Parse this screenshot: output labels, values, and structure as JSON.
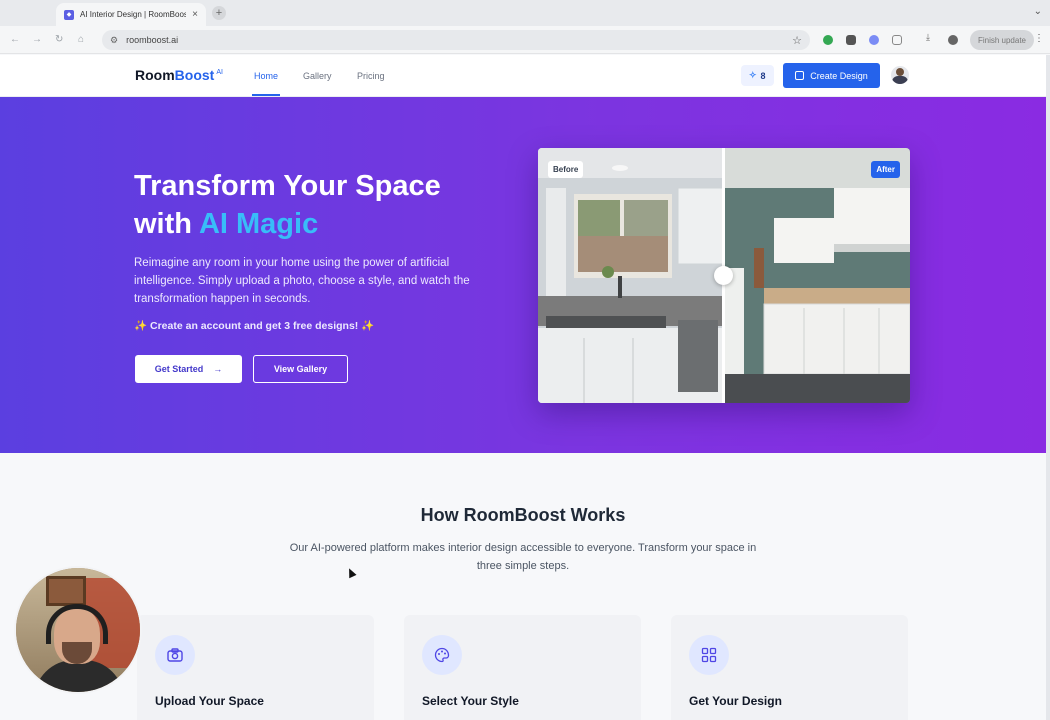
{
  "browser": {
    "tab_title": "AI Interior Design | RoomBoost",
    "tab_close": "×",
    "new_tab": "+",
    "url": "roomboost.ai",
    "finish_update": "Finish update"
  },
  "header": {
    "logo_room": "Room",
    "logo_boost": "Boost",
    "logo_ai": "AI",
    "nav": [
      {
        "label": "Home",
        "active": true
      },
      {
        "label": "Gallery",
        "active": false
      },
      {
        "label": "Pricing",
        "active": false
      }
    ],
    "credits": "8",
    "create_button": "Create Design"
  },
  "hero": {
    "title_line1": "Transform Your Space",
    "title_with": "with ",
    "title_accent": "AI Magic",
    "subtitle": "Reimagine any room in your home using the power of artificial intelligence. Simply upload a photo, choose a style, and watch the transformation happen in seconds.",
    "promo_icon_left": "✨",
    "promo": "Create an account and get 3 free designs!",
    "promo_icon_right": "✨",
    "get_started": "Get Started",
    "get_started_arrow": "→",
    "view_gallery": "View Gallery",
    "before_label": "Before",
    "after_label": "After"
  },
  "how": {
    "title": "How RoomBoost Works",
    "subtitle": "Our AI-powered platform makes interior design accessible to everyone. Transform your space in three simple steps.",
    "steps": [
      {
        "title": "Upload Your Space",
        "icon": "camera-icon"
      },
      {
        "title": "Select Your Style",
        "icon": "palette-icon"
      },
      {
        "title": "Get Your Design",
        "icon": "grid-icon"
      }
    ]
  },
  "colors": {
    "brand": "#2563eb",
    "hero_start": "#5b3fe0",
    "hero_end": "#8a2be2",
    "accent_text": "#38bdf8"
  }
}
